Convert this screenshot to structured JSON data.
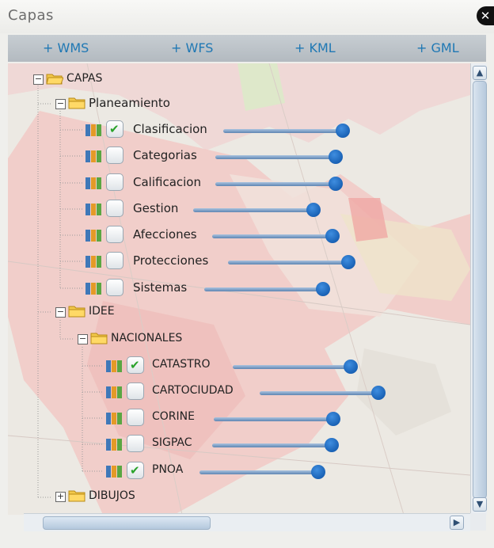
{
  "window": {
    "title": "Capas"
  },
  "add_links": [
    "+ WMS",
    "+ WFS",
    "+ KML",
    "+ GML"
  ],
  "tree": {
    "root_label": "CAPAS",
    "planeamiento": {
      "label": "Planeamiento",
      "layers": [
        {
          "label": "Clasificacion",
          "checked": true,
          "opacity": 1.0
        },
        {
          "label": "Categorias",
          "checked": false,
          "opacity": 1.0
        },
        {
          "label": "Calificacion",
          "checked": false,
          "opacity": 1.0
        },
        {
          "label": "Gestion",
          "checked": false,
          "opacity": 1.0
        },
        {
          "label": "Afecciones",
          "checked": false,
          "opacity": 1.0
        },
        {
          "label": "Protecciones",
          "checked": false,
          "opacity": 1.0
        },
        {
          "label": "Sistemas",
          "checked": false,
          "opacity": 1.0
        }
      ]
    },
    "idee": {
      "label": "IDEE",
      "nacionales": {
        "label": "NACIONALES",
        "layers": [
          {
            "label": "CATASTRO",
            "checked": true,
            "opacity": 1.0
          },
          {
            "label": "CARTOCIUDAD",
            "checked": false,
            "opacity": 1.0
          },
          {
            "label": "CORINE",
            "checked": false,
            "opacity": 1.0
          },
          {
            "label": "SIGPAC",
            "checked": false,
            "opacity": 1.0
          },
          {
            "label": "PNOA",
            "checked": true,
            "opacity": 1.0
          }
        ]
      }
    },
    "dibujos": {
      "label": "DIBUJOS"
    }
  },
  "icons": {
    "close": "close-icon",
    "expander_open": "minus-box-icon",
    "expander_closed": "plus-box-icon",
    "folder": "folder-icon",
    "layer": "layer-stack-icon",
    "check": "checkmark-icon",
    "scroll_up": "arrow-up-icon",
    "scroll_down": "arrow-down-icon",
    "scroll_left": "arrow-left-icon",
    "scroll_right": "arrow-right-icon"
  },
  "colors": {
    "accent": "#1f78b4",
    "slider_knob": "#0a4fa3",
    "check": "#2aa22a"
  }
}
